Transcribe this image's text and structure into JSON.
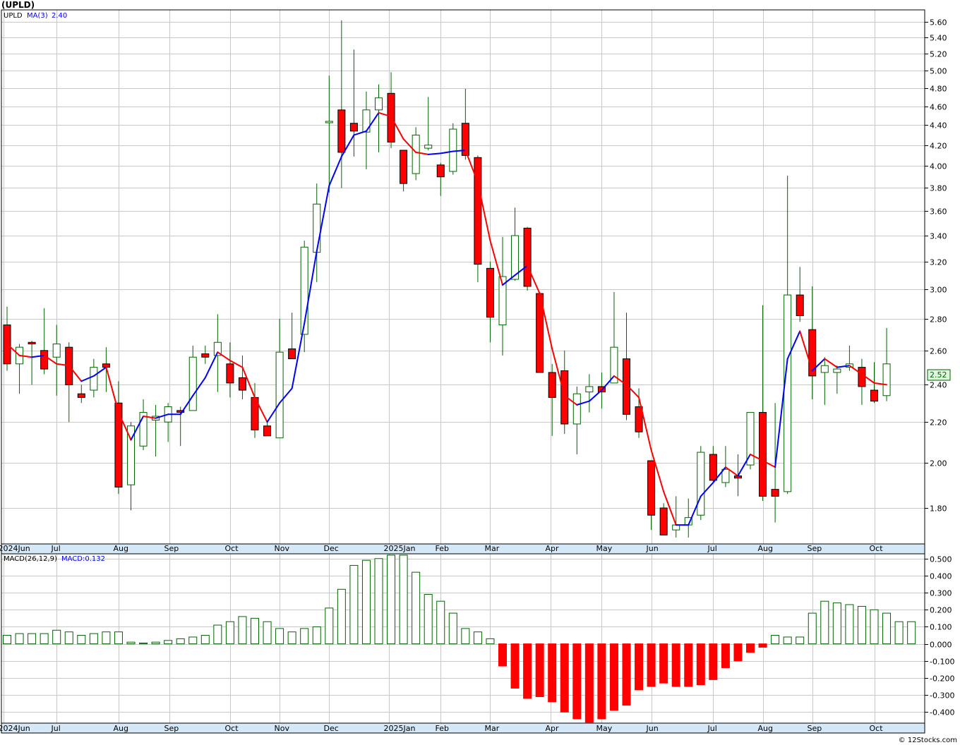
{
  "title": "(UPLD)",
  "footer": "© 12Stocks.com",
  "colors": {
    "up": "#006400",
    "down": "#ff0000",
    "ma_up": "#0000ff",
    "ma_down": "#ff0000",
    "grid": "#c8c8c8"
  },
  "chart_data": [
    {
      "type": "candlestick",
      "name": "UPLD",
      "legend": {
        "symbol": "UPLD",
        "ma_label": "MA(3)",
        "ma_value": "2.40"
      },
      "last_price_label": "2.52",
      "scale": "log",
      "ylim": [
        1.655,
        5.76
      ],
      "y_ticks": [
        "5.60",
        "5.40",
        "5.20",
        "5.00",
        "4.80",
        "4.60",
        "4.40",
        "4.20",
        "4.00",
        "3.80",
        "3.60",
        "3.40",
        "3.20",
        "3.00",
        "2.80",
        "2.60",
        "2.40",
        "2.20",
        "2.00",
        "1.80"
      ],
      "x_labels": [
        {
          "label": "2024Jun",
          "week": -0.3
        },
        {
          "label": "Jul",
          "week": 4.0
        },
        {
          "label": "Aug",
          "week": 9.0
        },
        {
          "label": "Sep",
          "week": 13.1
        },
        {
          "label": "Oct",
          "week": 18.0
        },
        {
          "label": "Nov",
          "week": 22.0
        },
        {
          "label": "Dec",
          "week": 26.0
        },
        {
          "label": "2025Jan",
          "week": 30.8
        },
        {
          "label": "Feb",
          "week": 35.0
        },
        {
          "label": "Mar",
          "week": 39.0
        },
        {
          "label": "Apr",
          "week": 43.9
        },
        {
          "label": "May",
          "week": 48.0
        },
        {
          "label": "Jun",
          "week": 52.0
        },
        {
          "label": "Jul",
          "week": 57.0
        },
        {
          "label": "Aug",
          "week": 61.0
        },
        {
          "label": "Sep",
          "week": 65.0
        },
        {
          "label": "Oct",
          "week": 70.0
        }
      ],
      "ohlc": [
        [
          2.76,
          2.88,
          2.48,
          2.52
        ],
        [
          2.52,
          2.64,
          2.35,
          2.62
        ],
        [
          2.65,
          2.66,
          2.4,
          2.64
        ],
        [
          2.6,
          2.87,
          2.46,
          2.49
        ],
        [
          2.56,
          2.76,
          2.34,
          2.64
        ],
        [
          2.62,
          2.65,
          2.2,
          2.4
        ],
        [
          2.35,
          2.4,
          2.3,
          2.33
        ],
        [
          2.37,
          2.55,
          2.33,
          2.5
        ],
        [
          2.52,
          2.62,
          2.36,
          2.5
        ],
        [
          2.3,
          2.42,
          1.86,
          1.89
        ],
        [
          1.9,
          2.2,
          1.79,
          2.18
        ],
        [
          2.08,
          2.32,
          2.06,
          2.25
        ],
        [
          2.21,
          2.29,
          2.03,
          2.23
        ],
        [
          2.2,
          2.3,
          2.1,
          2.28
        ],
        [
          2.26,
          2.28,
          2.08,
          2.25
        ],
        [
          2.26,
          2.63,
          2.26,
          2.56
        ],
        [
          2.58,
          2.63,
          2.52,
          2.56
        ],
        [
          2.57,
          2.83,
          2.36,
          2.65
        ],
        [
          2.52,
          2.65,
          2.33,
          2.41
        ],
        [
          2.44,
          2.57,
          2.32,
          2.37
        ],
        [
          2.33,
          2.41,
          2.12,
          2.16
        ],
        [
          2.18,
          2.2,
          2.13,
          2.13
        ],
        [
          2.12,
          2.8,
          2.12,
          2.59
        ],
        [
          2.61,
          2.84,
          2.6,
          2.55
        ],
        [
          2.7,
          3.36,
          2.59,
          3.31
        ],
        [
          3.27,
          3.84,
          3.05,
          3.66
        ],
        [
          4.44,
          4.94,
          3.76,
          4.44
        ],
        [
          4.56,
          5.62,
          3.8,
          4.13
        ],
        [
          4.42,
          5.25,
          4.09,
          4.34
        ],
        [
          4.33,
          4.76,
          3.97,
          4.56
        ],
        [
          4.56,
          4.84,
          4.13,
          4.69
        ],
        [
          4.74,
          4.98,
          4.17,
          4.23
        ],
        [
          4.15,
          4.14,
          3.77,
          3.84
        ],
        [
          3.93,
          4.38,
          3.87,
          4.3
        ],
        [
          4.17,
          4.7,
          4.15,
          4.2
        ],
        [
          4.01,
          4.03,
          3.73,
          3.9
        ],
        [
          3.95,
          4.42,
          3.92,
          4.36
        ],
        [
          4.42,
          4.79,
          4.06,
          4.1
        ],
        [
          4.08,
          4.1,
          3.05,
          3.18
        ],
        [
          3.15,
          3.2,
          2.65,
          2.81
        ],
        [
          2.76,
          3.39,
          2.57,
          3.09
        ],
        [
          3.07,
          3.63,
          3.06,
          3.4
        ],
        [
          3.46,
          3.47,
          2.99,
          3.02
        ],
        [
          2.97,
          2.98,
          2.48,
          2.47
        ],
        [
          2.47,
          2.52,
          2.13,
          2.33
        ],
        [
          2.48,
          2.6,
          2.14,
          2.19
        ],
        [
          2.19,
          2.39,
          2.04,
          2.35
        ],
        [
          2.36,
          2.46,
          2.25,
          2.39
        ],
        [
          2.39,
          2.47,
          2.27,
          2.36
        ],
        [
          2.41,
          2.98,
          2.41,
          2.62
        ],
        [
          2.55,
          2.84,
          2.21,
          2.24
        ],
        [
          2.28,
          2.38,
          2.12,
          2.15
        ],
        [
          2.01,
          2.0,
          1.71,
          1.77
        ],
        [
          1.8,
          1.82,
          1.69,
          1.69
        ],
        [
          1.71,
          1.85,
          1.68,
          1.73
        ],
        [
          1.73,
          1.84,
          1.68,
          1.76
        ],
        [
          1.77,
          2.08,
          1.75,
          2.05
        ],
        [
          2.04,
          2.08,
          1.91,
          1.92
        ],
        [
          1.91,
          2.08,
          1.89,
          1.97
        ],
        [
          1.94,
          2.04,
          1.85,
          1.93
        ],
        [
          1.99,
          2.24,
          1.97,
          2.25
        ],
        [
          2.25,
          2.89,
          1.83,
          1.85
        ],
        [
          1.88,
          2.3,
          1.74,
          1.85
        ],
        [
          1.87,
          3.91,
          1.86,
          2.96
        ],
        [
          2.96,
          3.16,
          2.78,
          2.82
        ],
        [
          2.73,
          3.02,
          2.32,
          2.45
        ],
        [
          2.47,
          2.56,
          2.29,
          2.51
        ],
        [
          2.47,
          2.51,
          2.35,
          2.49
        ],
        [
          2.5,
          2.63,
          2.48,
          2.52
        ],
        [
          2.5,
          2.55,
          2.29,
          2.39
        ],
        [
          2.37,
          2.53,
          2.3,
          2.31
        ],
        [
          2.34,
          2.74,
          2.31,
          2.52
        ]
      ],
      "ma3": [
        2.64,
        2.57,
        2.56,
        2.57,
        2.52,
        2.51,
        2.42,
        2.45,
        2.5,
        2.25,
        2.11,
        2.23,
        2.22,
        2.24,
        2.24,
        2.34,
        2.44,
        2.59,
        2.54,
        2.5,
        2.33,
        2.2,
        2.3,
        2.38,
        2.77,
        3.28,
        3.82,
        4.09,
        4.3,
        4.34,
        4.53,
        4.49,
        4.26,
        4.13,
        4.11,
        4.12,
        4.14,
        4.15,
        3.85,
        3.36,
        3.03,
        3.1,
        3.17,
        2.97,
        2.61,
        2.34,
        2.29,
        2.31,
        2.37,
        2.45,
        2.4,
        2.33,
        2.06,
        1.87,
        1.73,
        1.73,
        1.85,
        1.91,
        1.98,
        1.94,
        2.04,
        2.01,
        1.98,
        2.55,
        2.72,
        2.48,
        2.55,
        2.5,
        2.51,
        2.46,
        2.41,
        2.4
      ]
    },
    {
      "type": "bar",
      "name": "MACD",
      "legend": {
        "params": "MACD(26,12,9)",
        "value_label": "MACD:0.132"
      },
      "ylim": [
        -0.465,
        0.528
      ],
      "y_ticks": [
        "0.500",
        "0.400",
        "0.300",
        "0.200",
        "0.100",
        "0.000",
        "-0.100",
        "-0.200",
        "-0.300",
        "-0.400"
      ],
      "values": [
        0.05,
        0.06,
        0.06,
        0.06,
        0.08,
        0.07,
        0.05,
        0.06,
        0.07,
        0.07,
        0.01,
        0.005,
        0.01,
        0.02,
        0.03,
        0.04,
        0.05,
        0.11,
        0.13,
        0.16,
        0.15,
        0.13,
        0.09,
        0.07,
        0.09,
        0.1,
        0.21,
        0.32,
        0.46,
        0.49,
        0.5,
        0.52,
        0.52,
        0.42,
        0.29,
        0.25,
        0.18,
        0.09,
        0.07,
        0.03,
        -0.13,
        -0.26,
        -0.32,
        -0.31,
        -0.34,
        -0.4,
        -0.44,
        -0.46,
        -0.44,
        -0.39,
        -0.36,
        -0.27,
        -0.25,
        -0.23,
        -0.25,
        -0.25,
        -0.24,
        -0.21,
        -0.14,
        -0.1,
        -0.05,
        -0.02,
        0.05,
        0.04,
        0.04,
        0.18,
        0.25,
        0.24,
        0.23,
        0.22,
        0.2,
        0.18,
        0.13,
        0.13
      ]
    }
  ]
}
